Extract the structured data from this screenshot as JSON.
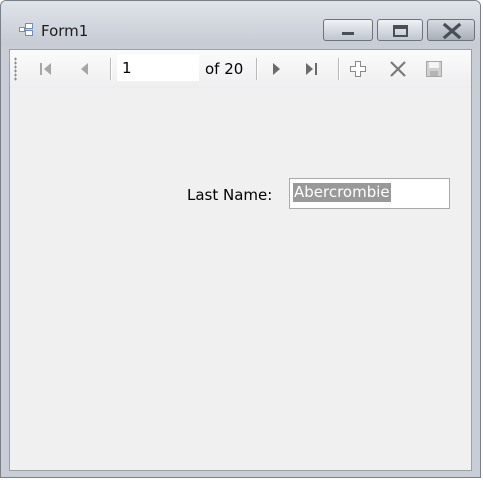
{
  "window": {
    "title": "Form1",
    "icons": {
      "app": "form-app-icon",
      "minimize": "minimize-icon",
      "maximize": "maximize-icon",
      "close": "close-icon"
    }
  },
  "navigator": {
    "position": "1",
    "count_label": "of 20",
    "icons": {
      "first": "move-first-icon",
      "previous": "move-previous-icon",
      "next": "move-next-icon",
      "last": "move-last-icon",
      "add": "add-new-icon",
      "delete": "delete-icon",
      "save": "save-icon"
    }
  },
  "form": {
    "last_name_label": "Last Name:",
    "last_name_value": "Abercrombie"
  }
}
